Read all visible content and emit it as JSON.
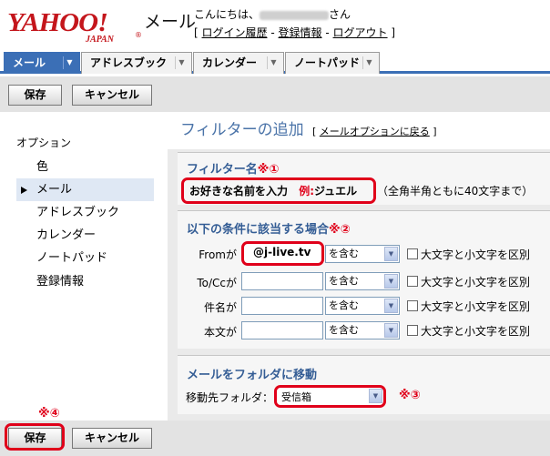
{
  "header": {
    "logo_text": "YAHOO!",
    "logo_sub": "JAPAN",
    "logo_reg": "®",
    "service_name": "メール",
    "greeting_prefix": "こんにちは、",
    "greeting_suffix": "さん",
    "links_open": "[",
    "login_history": "ログイン履歴",
    "sep1": "-",
    "registration": "登録情報",
    "sep2": "-",
    "logout": "ログアウト",
    "links_close": "]"
  },
  "tabs": [
    {
      "label": "メール",
      "active": true
    },
    {
      "label": "アドレスブック",
      "active": false
    },
    {
      "label": "カレンダー",
      "active": false
    },
    {
      "label": "ノートパッド",
      "active": false
    }
  ],
  "tab_dropdown_glyph": "▼",
  "toolbar": {
    "save_label": "保存",
    "cancel_label": "キャンセル"
  },
  "sidebar": {
    "title": "オプション",
    "items": [
      {
        "label": "色",
        "selected": false
      },
      {
        "label": "メール",
        "selected": true
      },
      {
        "label": "アドレスブック",
        "selected": false
      },
      {
        "label": "カレンダー",
        "selected": false
      },
      {
        "label": "ノートパッド",
        "selected": false
      },
      {
        "label": "登録情報",
        "selected": false
      }
    ]
  },
  "main": {
    "title": "フィルターの追加",
    "back_open": "[",
    "back_link": "メールオプションに戻る",
    "back_close": "]",
    "filter_name": {
      "heading": "フィルター名",
      "marker": "※①",
      "value_text": "お好きな名前を入力",
      "example_prefix": "例:",
      "example_value": "ジュエル",
      "hint": "（全角半角ともに40文字まで）"
    },
    "conditions": {
      "heading": "以下の条件に該当する場合",
      "marker": "※②",
      "rows": [
        {
          "label": "Fromが",
          "value": "@j-live.tv",
          "match": "を含む",
          "case_label": "大文字と小文字を区別"
        },
        {
          "label": "To/Ccが",
          "value": "",
          "match": "を含む",
          "case_label": "大文字と小文字を区別"
        },
        {
          "label": "件名が",
          "value": "",
          "match": "を含む",
          "case_label": "大文字と小文字を区別"
        },
        {
          "label": "本文が",
          "value": "",
          "match": "を含む",
          "case_label": "大文字と小文字を区別"
        }
      ]
    },
    "move": {
      "heading": "メールをフォルダに移動",
      "label": "移動先フォルダ：",
      "folder": "受信箱",
      "marker": "※③"
    }
  },
  "bottom": {
    "marker": "※④",
    "save_label": "保存",
    "cancel_label": "キャンセル"
  },
  "colors": {
    "accent": "#3b6fb6",
    "annotation_red": "#e0001a",
    "heading_blue": "#345d95",
    "brand_red": "#c4161c"
  }
}
